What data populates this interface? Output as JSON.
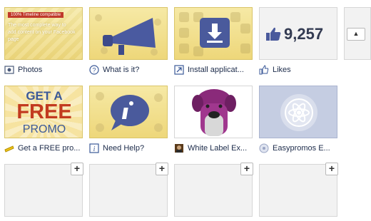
{
  "row1": [
    {
      "label": "Photos",
      "icon": "photos-icon",
      "banner_text": "100% Timeline compatible",
      "body_text": "The most complete way to add content on your Facebook page"
    },
    {
      "label": "What is it?",
      "icon": "question-globe-icon"
    },
    {
      "label": "Install applicat...",
      "icon": "install-app-icon"
    },
    {
      "label": "Likes",
      "icon": "thumbs-up-icon",
      "count": "9,257"
    }
  ],
  "row2": [
    {
      "label": "Get a FREE pro...",
      "icon": "coupon-icon",
      "promo_line1": "GET A",
      "promo_line2": "FREE",
      "promo_line3": "PROMO"
    },
    {
      "label": "Need Help?",
      "icon": "help-icon"
    },
    {
      "label": "White Label Ex...",
      "icon": "dog-avatar-icon"
    },
    {
      "label": "Easypromos E...",
      "icon": "gear-atom-icon"
    }
  ],
  "row3": [
    {
      "plus": "+"
    },
    {
      "plus": "+"
    },
    {
      "plus": "+"
    },
    {
      "plus": "+"
    }
  ],
  "scroll_up": "▲",
  "colors": {
    "link": "#3b5998",
    "gold_bg": "#f0dc86",
    "gold_border": "#d9c56a",
    "tile_border": "#d6d6d6"
  }
}
